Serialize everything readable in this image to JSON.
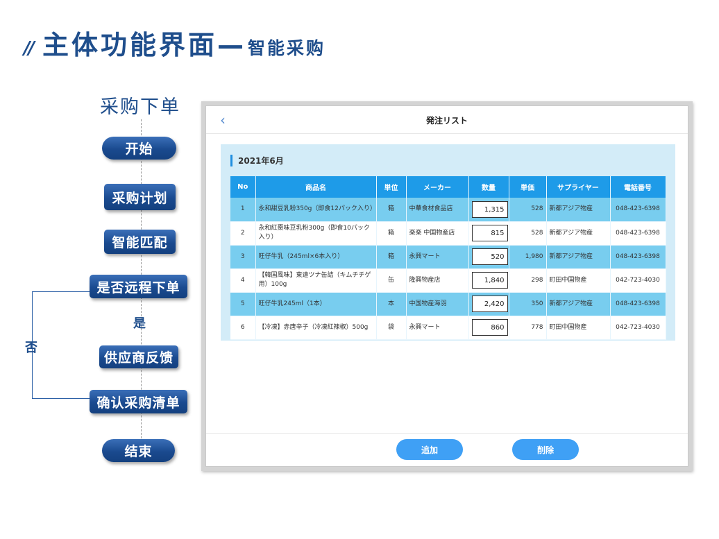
{
  "header": {
    "slash": "//",
    "title_main": "主体功能界面—",
    "title_sub": "智能采购"
  },
  "flowchart": {
    "title": "采购下单",
    "start": "开始",
    "steps": [
      "采购计划",
      "智能匹配",
      "是否远程下单",
      "供应商反馈",
      "确认采购清单"
    ],
    "end": "结束",
    "yes_label": "是",
    "no_label": "否"
  },
  "app": {
    "back_icon": "‹",
    "title": "発注リスト",
    "month": "2021年6月",
    "columns": [
      "No",
      "商品名",
      "単位",
      "メーカー",
      "数量",
      "単価",
      "サプライヤー",
      "電話番号"
    ],
    "rows": [
      {
        "no": "1",
        "name": "永和甜豆乳粉350g（即食12パック入り）",
        "unit": "箱",
        "maker": "中華食材食品店",
        "qty": "1,315",
        "price": "528",
        "supplier": "新都アジア物産",
        "phone": "048-423-6398"
      },
      {
        "no": "2",
        "name": "永和紅棗味豆乳粉300g（即食10パック入り）",
        "unit": "箱",
        "maker": "楽楽 中国物産店",
        "qty": "815",
        "price": "528",
        "supplier": "新都アジア物産",
        "phone": "048-423-6398"
      },
      {
        "no": "3",
        "name": "旺仔牛乳（245ml×6本入り）",
        "unit": "箱",
        "maker": "永興マート",
        "qty": "520",
        "price": "1,980",
        "supplier": "新都アジア物産",
        "phone": "048-423-6398"
      },
      {
        "no": "4",
        "name": "【韓国風味】東遠ツナ缶詰（キムチチゲ用）100g",
        "unit": "缶",
        "maker": "隆興物産店",
        "qty": "1,840",
        "price": "298",
        "supplier": "町田中国物産",
        "phone": "042-723-4030"
      },
      {
        "no": "5",
        "name": "旺仔牛乳245ml（1本）",
        "unit": "本",
        "maker": "中国物産海羽",
        "qty": "2,420",
        "price": "350",
        "supplier": "新都アジア物産",
        "phone": "048-423-6398"
      },
      {
        "no": "6",
        "name": "【冷凍】赤唐辛子（冷凍紅辣椒）500g",
        "unit": "袋",
        "maker": "永興マート",
        "qty": "860",
        "price": "778",
        "supplier": "町田中国物産",
        "phone": "042-723-4030"
      }
    ],
    "add_label": "追加",
    "delete_label": "削除"
  }
}
